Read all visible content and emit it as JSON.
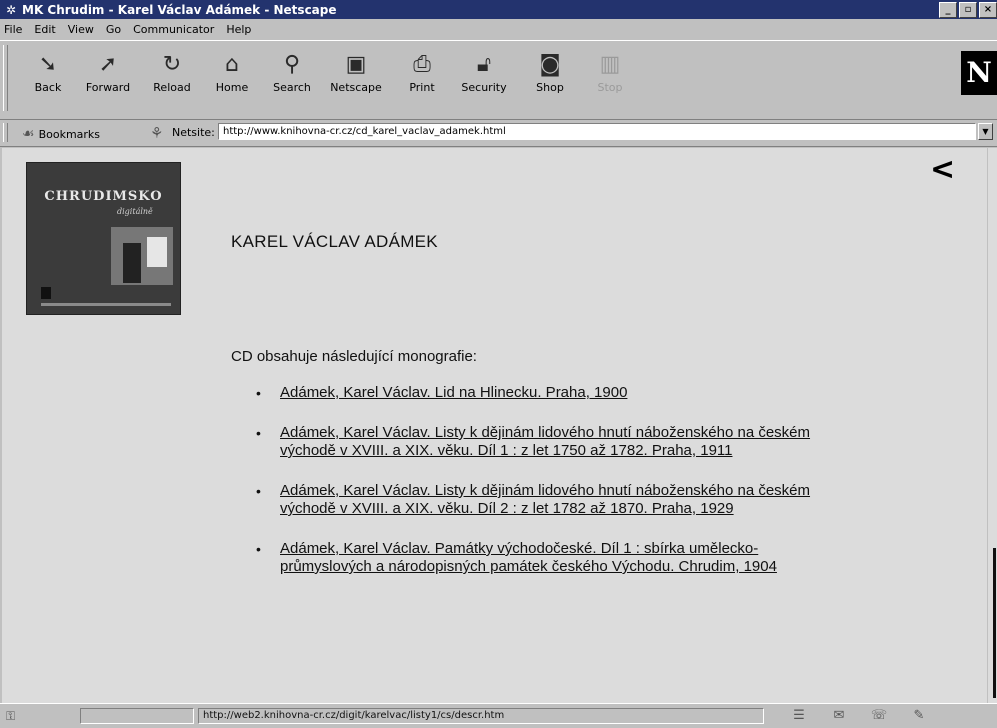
{
  "window": {
    "title": "MK Chrudim - Karel Václav Adámek - Netscape",
    "controls": [
      "_",
      "▫",
      "×"
    ]
  },
  "menu": [
    "File",
    "Edit",
    "View",
    "Go",
    "Communicator",
    "Help"
  ],
  "toolbar": {
    "buttons": [
      {
        "label": "Back",
        "icon": "back-arrow-icon",
        "enabled": true
      },
      {
        "label": "Forward",
        "icon": "forward-arrow-icon",
        "enabled": true
      },
      {
        "label": "Reload",
        "icon": "reload-icon",
        "enabled": true
      },
      {
        "label": "Home",
        "icon": "home-icon",
        "enabled": true
      },
      {
        "label": "Search",
        "icon": "search-icon",
        "enabled": true
      },
      {
        "label": "Netscape",
        "icon": "netscape-icon",
        "enabled": true
      },
      {
        "label": "Print",
        "icon": "print-icon",
        "enabled": true
      },
      {
        "label": "Security",
        "icon": "security-icon",
        "enabled": true
      },
      {
        "label": "Shop",
        "icon": "shop-icon",
        "enabled": true
      },
      {
        "label": "Stop",
        "icon": "stop-icon",
        "enabled": false
      }
    ],
    "logo": "N"
  },
  "location": {
    "bookmarks_label": "Bookmarks",
    "netsite_label": "Netsite:",
    "url": "http://www.knihovna-cr.cz/cd_karel_vaclav_adamek.html"
  },
  "page": {
    "cover_title": "CHRUDIMSKO",
    "cover_subtitle": "digitálně",
    "back_glyph": "<",
    "heading": "KAREL VÁCLAV ADÁMEK",
    "intro": "CD obsahuje následující monografie:",
    "bullet": "•",
    "monographs": [
      "Adámek, Karel Václav. Lid na Hlinecku. Praha, 1900",
      "Adámek, Karel Václav. Listy k dějinám lidového hnutí náboženského na českém východě v XVIII. a XIX. věku. Díl 1 : z let 1750 až 1782. Praha, 1911",
      "Adámek, Karel Václav. Listy k dějinám lidového hnutí náboženského na českém východě v XVIII. a XIX. věku. Díl 2 : z let 1782 až 1870. Praha, 1929",
      "Adámek, Karel Václav. Památky východočeské. Díl 1 : sbírka umělecko-průmyslových a národopisných památek českého Východu. Chrudim, 1904"
    ]
  },
  "status": {
    "url": "http://web2.knihovna-cr.cz/digit/karelvac/listy1/cs/descr.htm"
  }
}
